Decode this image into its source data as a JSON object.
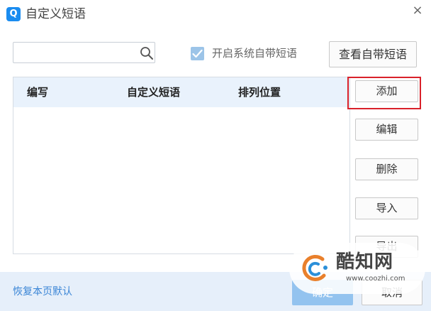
{
  "window": {
    "title": "自定义短语",
    "app_icon": "Q",
    "app_icon_name": "qq-app-icon",
    "close_icon_glyph": "×"
  },
  "toolbar": {
    "search_value": "",
    "search_placeholder": "",
    "builtin_checkbox_checked": true,
    "builtin_checkbox_label": "开启系统自带短语",
    "view_builtin_label": "查看自带短语"
  },
  "table": {
    "columns": [
      "编写",
      "自定义短语",
      "排列位置"
    ],
    "rows": []
  },
  "actions": {
    "add": "添加",
    "edit": "编辑",
    "delete": "删除",
    "import": "导入",
    "export": "导出"
  },
  "footer": {
    "restore_defaults": "恢复本页默认",
    "ok": "确定",
    "cancel": "取消"
  },
  "watermark": {
    "name": "酷知网",
    "url": "www.coozhi.com"
  },
  "colors": {
    "accent": "#1a8cf0",
    "highlight": "#d9212a",
    "header_bg": "#e9f2fc",
    "footer_bg": "#e6effa",
    "link": "#3a85d6"
  }
}
